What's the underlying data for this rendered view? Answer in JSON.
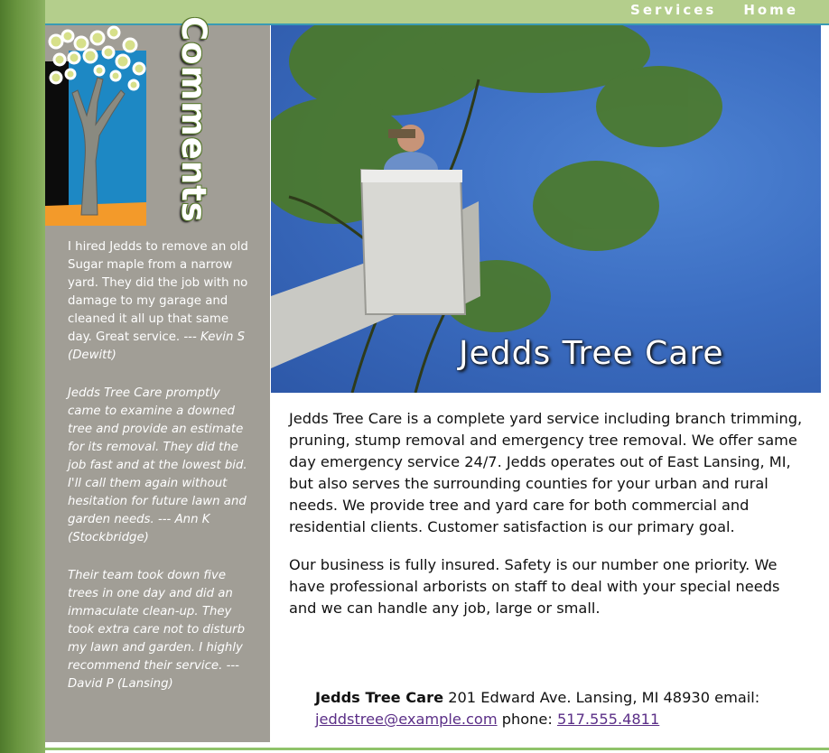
{
  "nav": {
    "services": "Services",
    "home": "Home"
  },
  "sidebar": {
    "heading": "Comments",
    "testimonials": [
      {
        "text": "I hired Jedds to remove an old Sugar maple from a narrow yard. They did the job with no damage to my garage and cleaned it all up that same day. Great service.",
        "author": " --- Kevin S (Dewitt)"
      },
      {
        "text": "Jedds Tree Care promptly came to examine a downed tree and provide an estimate for its removal. They did the job fast and at the lowest bid. I'll call them again without hesitation for future lawn and garden needs.",
        "author": " --- Ann K (Stockbridge)"
      },
      {
        "text": "Their team took down five trees in one day and did an immaculate clean-up. They took extra care not to disturb my lawn and garden. I highly recommend their service.",
        "author": " --- David P (Lansing)"
      }
    ]
  },
  "hero": {
    "title": "Jedds Tree Care"
  },
  "main": {
    "paragraphs": [
      "Jedds Tree Care is a complete yard service including branch trimming, pruning, stump removal and emergency tree removal. We offer same day emergency service 24/7. Jedds operates out of East Lansing, MI, but also serves the surrounding counties for your urban and rural needs. We provide tree and yard care for both commercial and residential clients. Customer satisfaction is our primary goal.",
      "Our business is fully insured. Safety is our number one priority. We have professional arborists on staff to deal with your special needs and we can handle any job, large or small."
    ]
  },
  "contact": {
    "company": "Jedds Tree Care",
    "address": " 201 Edward Ave. Lansing, MI 48930 email: ",
    "email": "jeddstree@example.com",
    "phone_label": " phone: ",
    "phone": "517.555.4811"
  },
  "colors": {
    "topbar": "#b4ce8c",
    "sidebar": "#a19e96",
    "accent_orange": "#f39a2a",
    "accent_blue": "#1d88c4",
    "link": "#5b2f87"
  }
}
